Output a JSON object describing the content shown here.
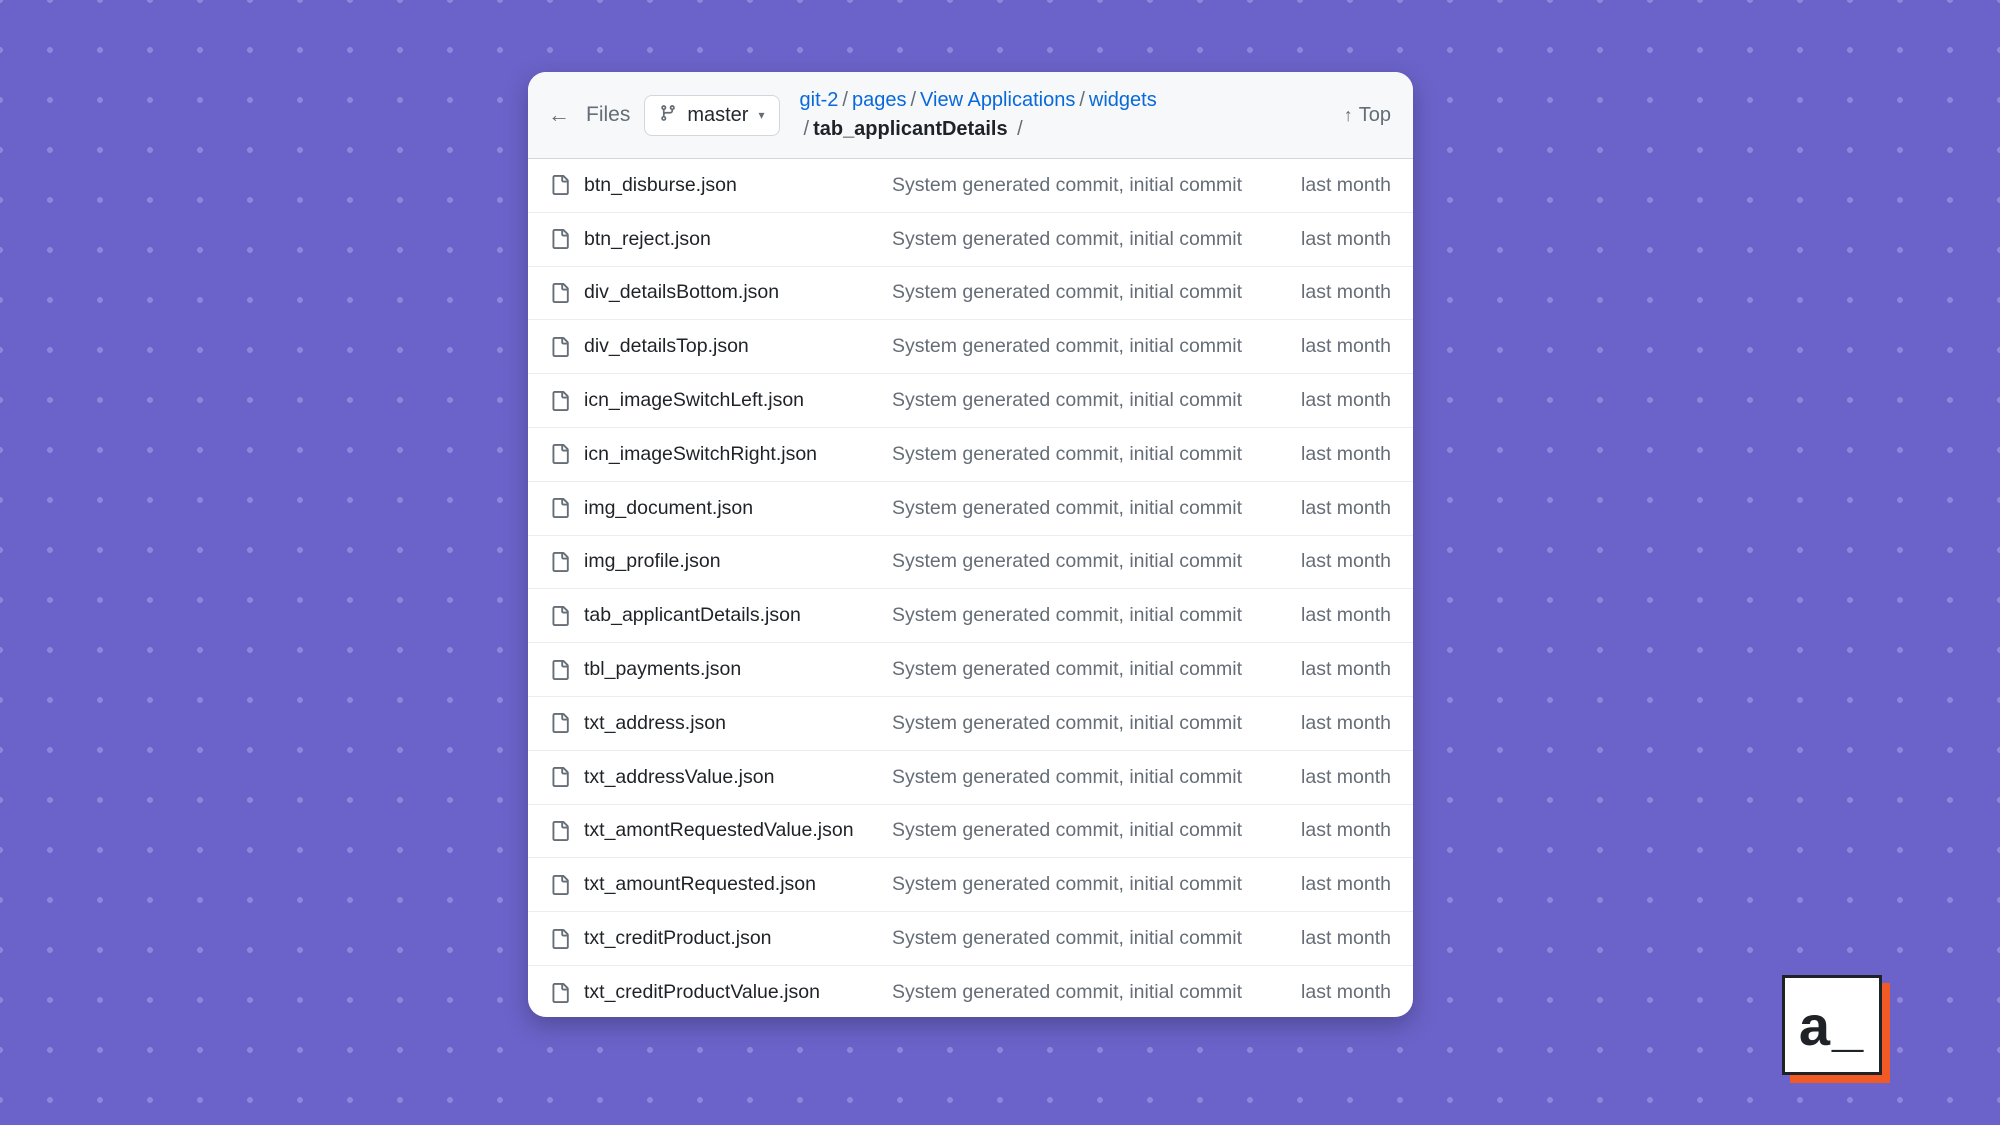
{
  "header": {
    "files_label": "Files",
    "branch": "master",
    "top_label": "Top"
  },
  "breadcrumbs": {
    "root": "git-2",
    "segments": [
      "pages",
      "View Applications",
      "widgets"
    ],
    "current": "tab_applicantDetails"
  },
  "files": [
    {
      "name": "btn_disburse.json",
      "commit": "System generated commit, initial commit",
      "time": "last month"
    },
    {
      "name": "btn_reject.json",
      "commit": "System generated commit, initial commit",
      "time": "last month"
    },
    {
      "name": "div_detailsBottom.json",
      "commit": "System generated commit, initial commit",
      "time": "last month"
    },
    {
      "name": "div_detailsTop.json",
      "commit": "System generated commit, initial commit",
      "time": "last month"
    },
    {
      "name": "icn_imageSwitchLeft.json",
      "commit": "System generated commit, initial commit",
      "time": "last month"
    },
    {
      "name": "icn_imageSwitchRight.json",
      "commit": "System generated commit, initial commit",
      "time": "last month"
    },
    {
      "name": "img_document.json",
      "commit": "System generated commit, initial commit",
      "time": "last month"
    },
    {
      "name": "img_profile.json",
      "commit": "System generated commit, initial commit",
      "time": "last month"
    },
    {
      "name": "tab_applicantDetails.json",
      "commit": "System generated commit, initial commit",
      "time": "last month"
    },
    {
      "name": "tbl_payments.json",
      "commit": "System generated commit, initial commit",
      "time": "last month"
    },
    {
      "name": "txt_address.json",
      "commit": "System generated commit, initial commit",
      "time": "last month"
    },
    {
      "name": "txt_addressValue.json",
      "commit": "System generated commit, initial commit",
      "time": "last month"
    },
    {
      "name": "txt_amontRequestedValue.json",
      "commit": "System generated commit, initial commit",
      "time": "last month"
    },
    {
      "name": "txt_amountRequested.json",
      "commit": "System generated commit, initial commit",
      "time": "last month"
    },
    {
      "name": "txt_creditProduct.json",
      "commit": "System generated commit, initial commit",
      "time": "last month"
    },
    {
      "name": "txt_creditProductValue.json",
      "commit": "System generated commit, initial commit",
      "time": "last month"
    }
  ],
  "logo": {
    "text": "a_"
  }
}
